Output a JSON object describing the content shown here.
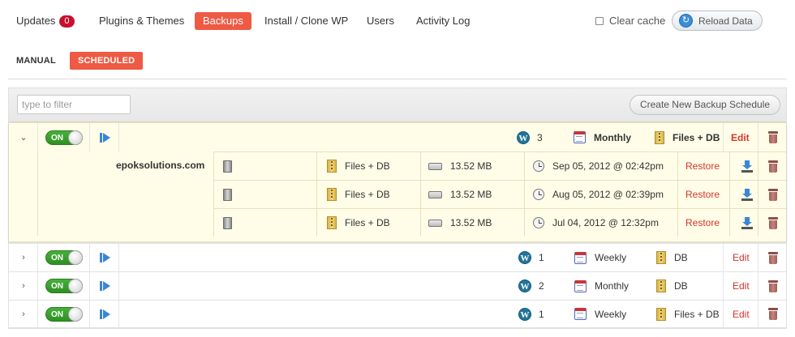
{
  "nav": {
    "items": [
      {
        "label": "Updates",
        "badge": "0"
      },
      {
        "label": "Plugins & Themes"
      },
      {
        "label": "Backups",
        "active": true
      },
      {
        "label": "Install / Clone WP"
      },
      {
        "label": "Users"
      },
      {
        "label": "Activity Log"
      }
    ],
    "clear_cache_label": "Clear cache",
    "reload_label": "Reload Data"
  },
  "subnav": {
    "manual_label": "MANUAL",
    "scheduled_label": "SCHEDULED",
    "active": "SCHEDULED"
  },
  "filter": {
    "placeholder": "type to filter",
    "value": ""
  },
  "create_schedule_label": "Create New Backup Schedule",
  "expanded_schedule": {
    "toggle_label": "ON",
    "sites_count": "3",
    "frequency": "Monthly",
    "backup_type": "Files + DB",
    "edit_label": "Edit",
    "site_name": "epoksolutions.com",
    "backups": [
      {
        "type": "Files + DB",
        "size": "13.52 MB",
        "date": "Sep 05, 2012 @ 02:42pm",
        "restore_label": "Restore"
      },
      {
        "type": "Files + DB",
        "size": "13.52 MB",
        "date": "Aug 05, 2012 @ 02:39pm",
        "restore_label": "Restore"
      },
      {
        "type": "Files + DB",
        "size": "13.52 MB",
        "date": "Jul 04, 2012 @ 12:32pm",
        "restore_label": "Restore"
      }
    ]
  },
  "schedules": [
    {
      "toggle_label": "ON",
      "sites_count": "1",
      "frequency": "Weekly",
      "backup_type": "DB",
      "edit_label": "Edit"
    },
    {
      "toggle_label": "ON",
      "sites_count": "2",
      "frequency": "Monthly",
      "backup_type": "DB",
      "edit_label": "Edit"
    },
    {
      "toggle_label": "ON",
      "sites_count": "1",
      "frequency": "Weekly",
      "backup_type": "Files + DB",
      "edit_label": "Edit"
    }
  ],
  "colors": {
    "accent": "#ee5a43",
    "badge": "#c8102e",
    "link_red": "#d6352a",
    "toggle_green": "#3aa02e",
    "expanded_bg": "#fffde8"
  }
}
